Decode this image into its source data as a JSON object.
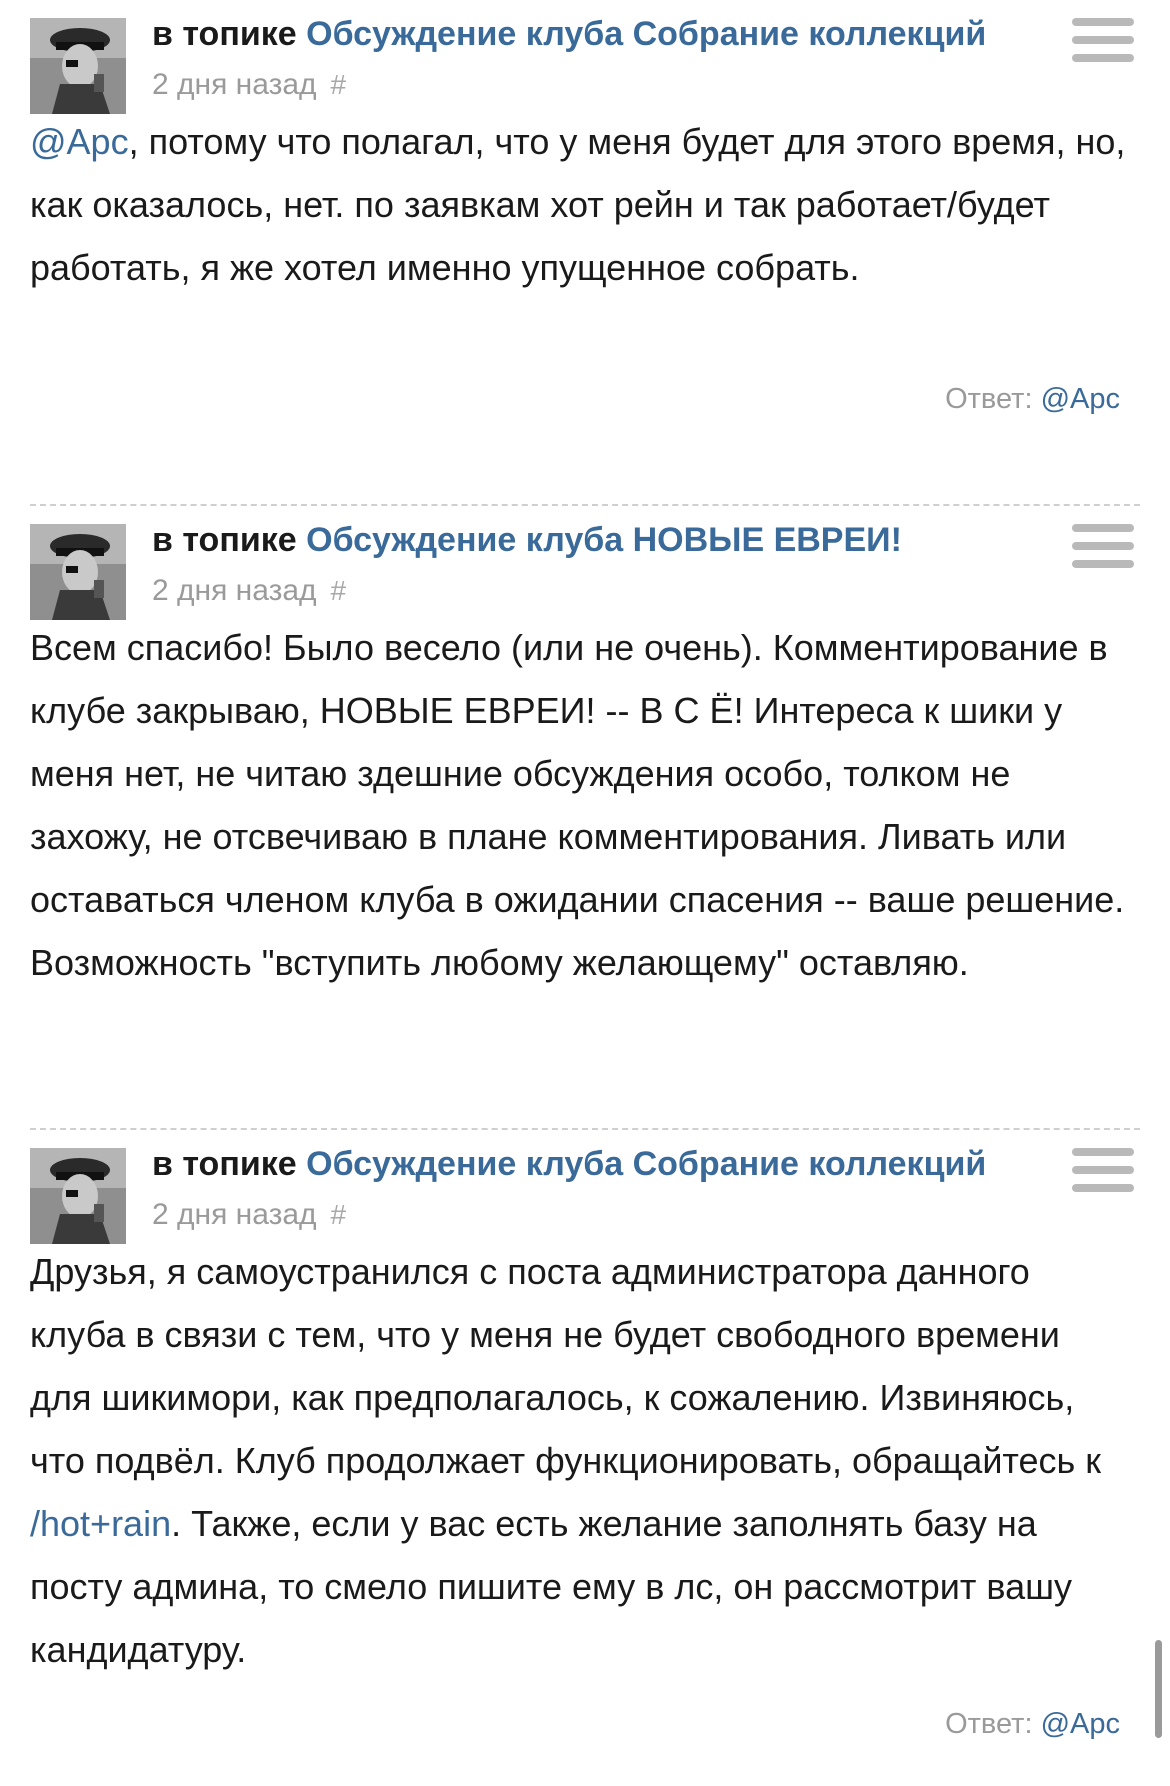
{
  "posts": [
    {
      "topic_prefix": "в топике",
      "topic_link": "Обсуждение клуба Собрание коллекций",
      "time": "2 дня назад",
      "hash": "#",
      "body": [
        {
          "type": "mention",
          "text": "@Арс"
        },
        {
          "type": "text",
          "text": ", потому что полагал, что у меня будет для этого время, но, как оказалось, нет. по заявкам хот рейн и так работает/будет работать, я же хотел именно упущенное собрать."
        }
      ],
      "reply_label": "Ответ:",
      "reply_to": "@Арс"
    },
    {
      "topic_prefix": "в топике",
      "topic_link": "Обсуждение клуба НОВЫЕ ЕВРЕИ!",
      "time": "2 дня назад",
      "hash": "#",
      "body": [
        {
          "type": "text",
          "text": "Всем спасибо! Было весело (или не очень). Комментирование в клубе закрываю, НОВЫЕ ЕВРЕИ! -- В С Ё! Интереса к шики у меня нет, не читаю здешние обсуждения особо, толком не захожу, не отсвечиваю в плане комментирования. Ливать или оставаться членом клуба в ожидании спасения -- ваше решение. Возможность \"вступить любому желающему\" оставляю."
        }
      ]
    },
    {
      "topic_prefix": "в топике",
      "topic_link": "Обсуждение клуба Собрание коллекций",
      "time": "2 дня назад",
      "hash": "#",
      "body": [
        {
          "type": "text",
          "text": "Друзья, я самоустранился с поста администратора данного клуба в связи с тем, что у меня не будет свободного времени для шикимори, как предполагалось, к сожалению. Извиняюсь, что подвёл. Клуб продолжает функционировать, обращайтесь к "
        },
        {
          "type": "link",
          "text": "/hot+rain"
        },
        {
          "type": "text",
          "text": ". Также, если у вас есть желание заполнять базу на посту админа, то смело пишите ему в лс, он рассмотрит вашу кандидатуру."
        }
      ],
      "reply_label": "Ответ:",
      "reply_to": "@Арс"
    }
  ],
  "colors": {
    "link": "#3a6a9a",
    "meta": "#9a9a9a",
    "divider": "#cfcfcf",
    "menu": "#b9b9b9"
  },
  "icons": {
    "menu": "hamburger-menu-icon",
    "avatar": "user-avatar-photo"
  }
}
